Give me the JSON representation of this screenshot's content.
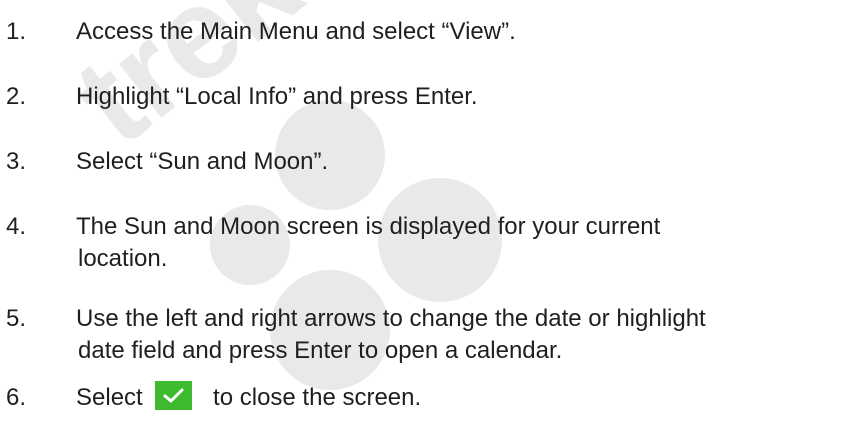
{
  "steps": [
    {
      "number": "1.",
      "text": "Access the Main Menu and select “View”."
    },
    {
      "number": "2.",
      "text": "Highlight “Local Info” and press Enter."
    },
    {
      "number": "3.",
      "text": "Select “Sun and Moon”."
    },
    {
      "number": "4.",
      "line1": "The Sun and Moon screen is displayed for your current",
      "line2": "location."
    },
    {
      "number": "5.",
      "line1": "Use the left and right arrows to change the date or highlight",
      "line2": "date field and press Enter to open a calendar."
    },
    {
      "number": "6.",
      "before": "Select",
      "after": "to close the screen."
    }
  ],
  "watermark": {
    "text": "trek",
    "color": "#e6e6e6"
  },
  "accent": {
    "check_button_color": "#3dba2d"
  },
  "icons": {
    "inline_button": "checkmark-icon"
  }
}
